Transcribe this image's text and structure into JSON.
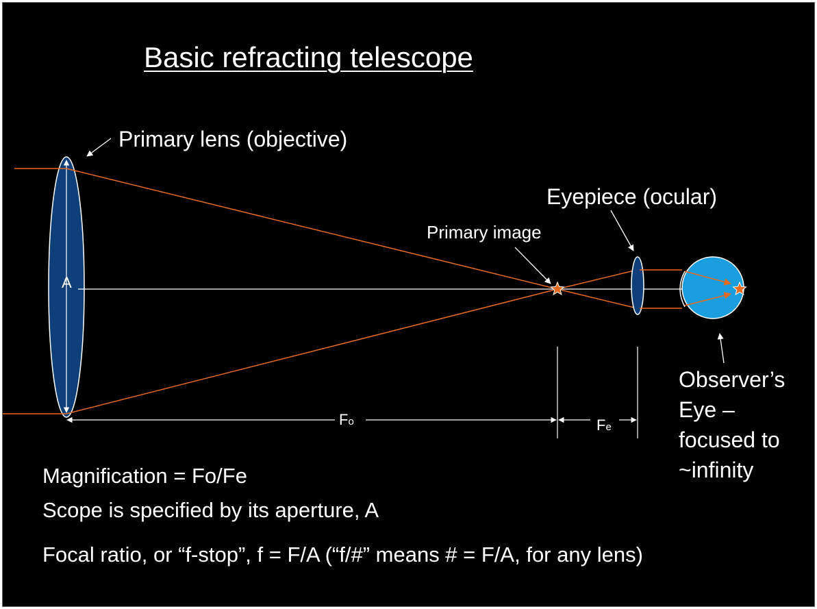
{
  "title": "Basic refracting telescope",
  "labels": {
    "primary_lens": "Primary lens (objective)",
    "eyepiece": "Eyepiece (ocular)",
    "primary_image": "Primary image",
    "aperture": "A",
    "focal_objective_main": "F",
    "focal_objective_sub": "o",
    "focal_eyepiece_main": "F",
    "focal_eyepiece_sub": "e",
    "observer_eye": "Observer’s Eye – focused to ~infinity"
  },
  "formulas": {
    "magnification": "Magnification = Fo/Fe",
    "aperture_spec": "Scope is specified by its aperture, A",
    "focal_ratio": "Focal ratio, or “f-stop”,  f = F/A   (“f/#” means # = F/A, for any lens)"
  },
  "colors": {
    "background": "#000000",
    "lens_fill": "#0e3f78",
    "eye_fill": "#1a9ee0",
    "ray": "#e86a1e",
    "axis": "#ffffff",
    "star": "#e86a1e"
  }
}
